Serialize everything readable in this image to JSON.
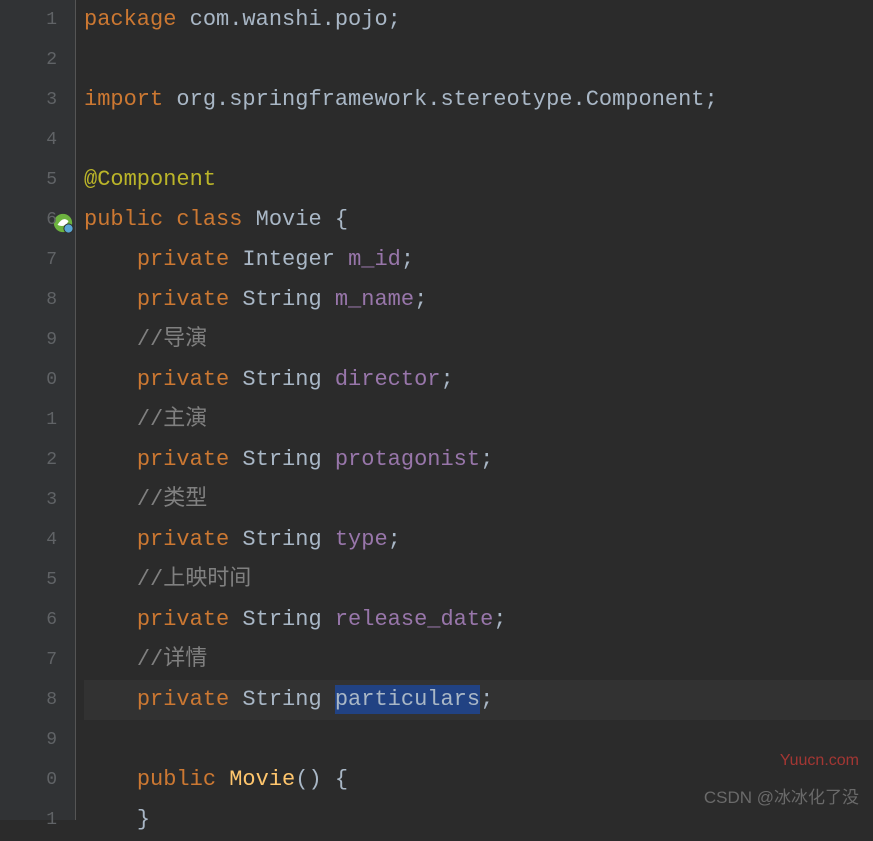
{
  "lines": {
    "nums": [
      "1",
      "2",
      "3",
      "4",
      "5",
      "6",
      "7",
      "8",
      "9",
      "0",
      "1",
      "2",
      "3",
      "4",
      "5",
      "6",
      "7",
      "8",
      "9",
      "0",
      "1"
    ],
    "code": [
      {
        "indent": "",
        "tokens": [
          {
            "c": "kw",
            "t": "package"
          },
          {
            "c": "plain",
            "t": " com.wanshi.pojo;"
          }
        ]
      },
      {
        "indent": "",
        "tokens": []
      },
      {
        "indent": "",
        "tokens": [
          {
            "c": "kw",
            "t": "import"
          },
          {
            "c": "plain",
            "t": " org.springframework.stereotype."
          },
          {
            "c": "import-cls",
            "t": "Component"
          },
          {
            "c": "plain",
            "t": ";"
          }
        ]
      },
      {
        "indent": "",
        "tokens": []
      },
      {
        "indent": "",
        "tokens": [
          {
            "c": "ann",
            "t": "@Component"
          }
        ]
      },
      {
        "indent": "",
        "tokens": [
          {
            "c": "kw",
            "t": "public class"
          },
          {
            "c": "plain",
            "t": " Movie {"
          }
        ]
      },
      {
        "indent": "    ",
        "tokens": [
          {
            "c": "kw",
            "t": "private"
          },
          {
            "c": "plain",
            "t": " Integer "
          },
          {
            "c": "field",
            "t": "m_id"
          },
          {
            "c": "plain",
            "t": ";"
          }
        ]
      },
      {
        "indent": "    ",
        "tokens": [
          {
            "c": "kw",
            "t": "private"
          },
          {
            "c": "plain",
            "t": " String "
          },
          {
            "c": "field",
            "t": "m_name"
          },
          {
            "c": "plain",
            "t": ";"
          }
        ]
      },
      {
        "indent": "    ",
        "tokens": [
          {
            "c": "cmt",
            "t": "//导演"
          }
        ]
      },
      {
        "indent": "    ",
        "tokens": [
          {
            "c": "kw",
            "t": "private"
          },
          {
            "c": "plain",
            "t": " String "
          },
          {
            "c": "field",
            "t": "director"
          },
          {
            "c": "plain",
            "t": ";"
          }
        ]
      },
      {
        "indent": "    ",
        "tokens": [
          {
            "c": "cmt",
            "t": "//主演"
          }
        ]
      },
      {
        "indent": "    ",
        "tokens": [
          {
            "c": "kw",
            "t": "private"
          },
          {
            "c": "plain",
            "t": " String "
          },
          {
            "c": "field",
            "t": "protagonist"
          },
          {
            "c": "plain",
            "t": ";"
          }
        ]
      },
      {
        "indent": "    ",
        "tokens": [
          {
            "c": "cmt",
            "t": "//类型"
          }
        ]
      },
      {
        "indent": "    ",
        "tokens": [
          {
            "c": "kw",
            "t": "private"
          },
          {
            "c": "plain",
            "t": " String "
          },
          {
            "c": "field",
            "t": "type"
          },
          {
            "c": "plain",
            "t": ";"
          }
        ]
      },
      {
        "indent": "    ",
        "tokens": [
          {
            "c": "cmt",
            "t": "//上映时间"
          }
        ]
      },
      {
        "indent": "    ",
        "tokens": [
          {
            "c": "kw",
            "t": "private"
          },
          {
            "c": "plain",
            "t": " String "
          },
          {
            "c": "field",
            "t": "release_date"
          },
          {
            "c": "plain",
            "t": ";"
          }
        ]
      },
      {
        "indent": "    ",
        "tokens": [
          {
            "c": "cmt",
            "t": "//详情"
          }
        ]
      },
      {
        "indent": "    ",
        "tokens": [
          {
            "c": "kw",
            "t": "private"
          },
          {
            "c": "plain",
            "t": " String "
          },
          {
            "c": "selected",
            "t": "particulars"
          },
          {
            "c": "plain",
            "t": ";"
          }
        ],
        "current": true
      },
      {
        "indent": "",
        "tokens": []
      },
      {
        "indent": "    ",
        "tokens": [
          {
            "c": "kw",
            "t": "public"
          },
          {
            "c": "plain",
            "t": " "
          },
          {
            "c": "method",
            "t": "Movie"
          },
          {
            "c": "plain",
            "t": "() {"
          }
        ]
      },
      {
        "indent": "    ",
        "tokens": [
          {
            "c": "plain",
            "t": "}"
          }
        ]
      }
    ]
  },
  "watermarks": {
    "w1": "Yuucn.com",
    "w2": "CSDN @冰冰化了没"
  }
}
